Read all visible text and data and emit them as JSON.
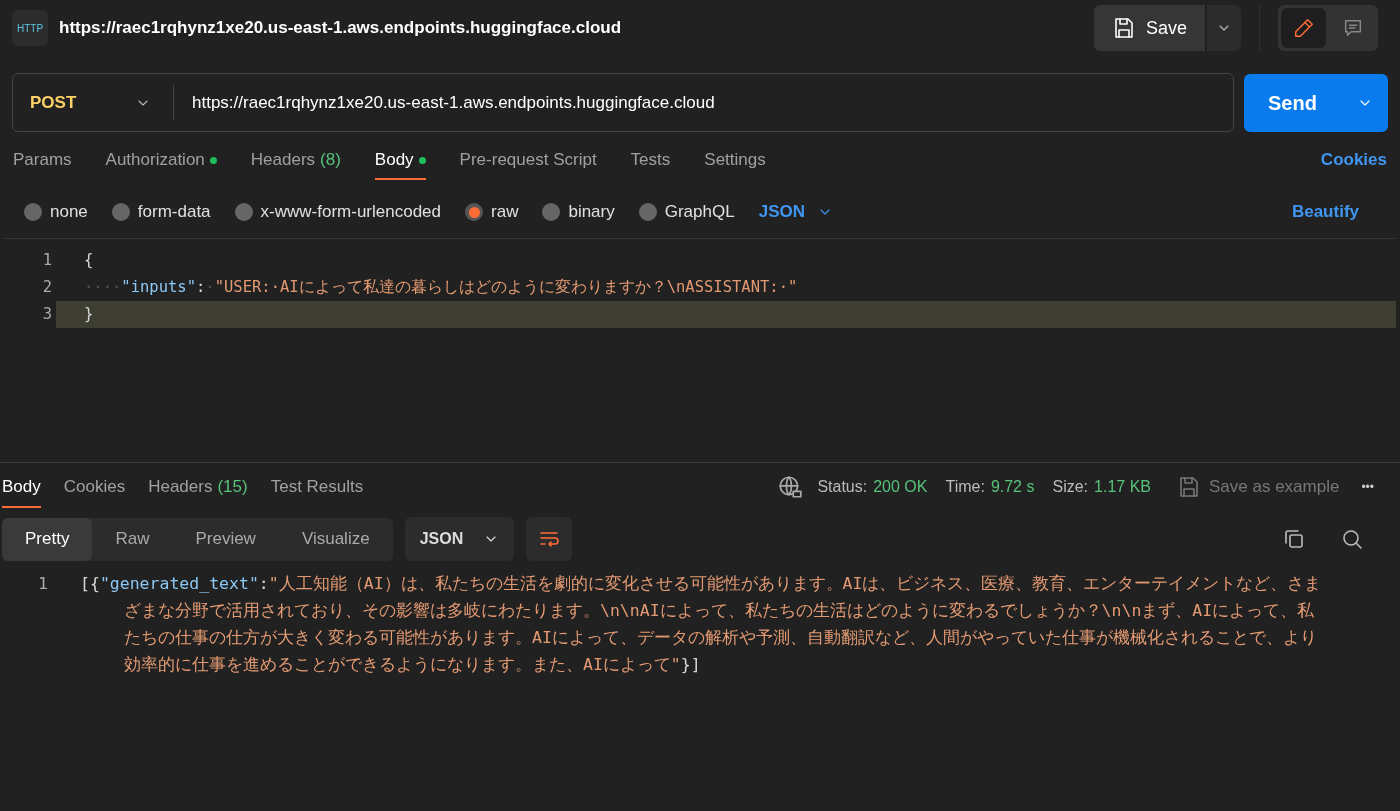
{
  "header": {
    "icon_text": "HTTP",
    "title": "https://raec1rqhynz1xe20.us-east-1.aws.endpoints.huggingface.cloud",
    "save_label": "Save",
    "modes": [
      {
        "kind": "edit",
        "selected": true
      },
      {
        "kind": "comment",
        "selected": false
      }
    ]
  },
  "request": {
    "method": "POST",
    "url": "https://raec1rqhynz1xe20.us-east-1.aws.endpoints.huggingface.cloud",
    "send_label": "Send"
  },
  "request_tabs": [
    {
      "label": "Params",
      "selected": false,
      "dot": false
    },
    {
      "label": "Authorization",
      "selected": false,
      "dot": true
    },
    {
      "label": "Headers",
      "count": "(8)",
      "selected": false,
      "dot": false
    },
    {
      "label": "Body",
      "selected": true,
      "dot": true
    },
    {
      "label": "Pre-request Script",
      "selected": false,
      "dot": false
    },
    {
      "label": "Tests",
      "selected": false,
      "dot": false
    },
    {
      "label": "Settings",
      "selected": false,
      "dot": false
    }
  ],
  "cookies_link": "Cookies",
  "body_types": [
    {
      "label": "none",
      "selected": false
    },
    {
      "label": "form-data",
      "selected": false
    },
    {
      "label": "x-www-form-urlencoded",
      "selected": false
    },
    {
      "label": "raw",
      "selected": true
    },
    {
      "label": "binary",
      "selected": false
    },
    {
      "label": "GraphQL",
      "selected": false
    }
  ],
  "body_language": "JSON",
  "beautify_link": "Beautify",
  "request_body": [
    {
      "number": "1",
      "current": false,
      "tokens": [
        {
          "kind": "punct",
          "text": "{"
        }
      ]
    },
    {
      "number": "2",
      "current": false,
      "tokens": [
        {
          "kind": "whitespace",
          "text": "····"
        },
        {
          "kind": "key",
          "text": "\"inputs\""
        },
        {
          "kind": "punct",
          "text": ":"
        },
        {
          "kind": "whitespace",
          "text": "·"
        },
        {
          "kind": "string",
          "text": "\"USER:·AIによって私達の暮らしはどのように変わりますか？\\nASSISTANT:·\""
        }
      ]
    },
    {
      "number": "3",
      "current": true,
      "tokens": [
        {
          "kind": "punct",
          "text": "}"
        }
      ]
    }
  ],
  "response_tabs": [
    {
      "label": "Body",
      "selected": true
    },
    {
      "label": "Cookies",
      "selected": false
    },
    {
      "label": "Headers",
      "count": "(15)",
      "selected": false
    },
    {
      "label": "Test Results",
      "selected": false
    }
  ],
  "response_meta": [
    {
      "label": "Status:",
      "value": "200 OK"
    },
    {
      "label": "Time:",
      "value": "9.72 s"
    },
    {
      "label": "Size:",
      "value": "1.17 KB"
    }
  ],
  "save_example": "Save as example",
  "more_icon": "•••",
  "format_tabs": [
    {
      "label": "Pretty",
      "selected": true
    },
    {
      "label": "Raw",
      "selected": false
    },
    {
      "label": "Preview",
      "selected": false
    },
    {
      "label": "Visualize",
      "selected": false
    }
  ],
  "response_language": "JSON",
  "response_body": [
    {
      "number": "1",
      "tokens": [
        {
          "kind": "punct",
          "text": "[{"
        },
        {
          "kind": "key",
          "text": "\"generated_text\""
        },
        {
          "kind": "punct",
          "text": ":"
        },
        {
          "kind": "string",
          "text": "\"人工知能（AI）は、私たちの生活を劇的に変化させる可能性があります。AIは、ビジネス、医療、教育、エンターテイメントなど、さまざまな分野で活用されており、その影響は多岐にわたります。\\n\\nAIによって、私たちの生活はどのように変わるでしょうか？\\n\\nまず、AIによって、私たちの仕事の仕方が大きく変わる可能性があります。AIによって、データの解析や予測、自動翻訳など、人間がやっていた仕事が機械化されることで、より効率的に仕事を進めることができるようになります。また、AIによって\""
        },
        {
          "kind": "punct",
          "text": "}]"
        }
      ]
    }
  ]
}
